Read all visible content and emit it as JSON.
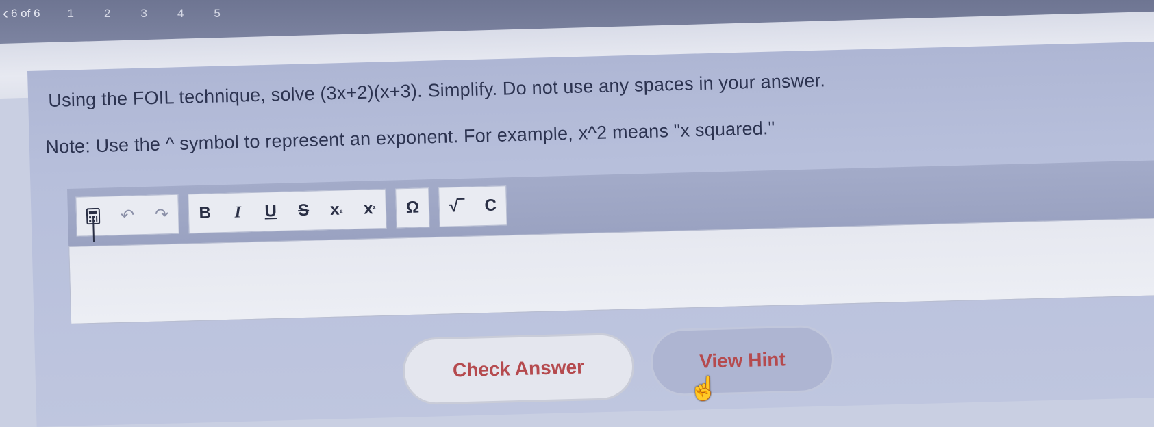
{
  "nav": {
    "back_icon": "chevron-left-icon",
    "counter": "6 of 6",
    "pages": [
      "1",
      "2",
      "3",
      "4",
      "5"
    ]
  },
  "question": {
    "text": "Using the FOIL technique, solve (3x+2)(x+3). Simplify. Do not use any spaces in your answer.",
    "note": "Note: Use the ^ symbol to represent an exponent. For example, x^2 means \"x squared.\""
  },
  "toolbar": {
    "calculator_icon": "calculator-icon",
    "undo_icon": "undo-icon",
    "redo_icon": "redo-icon",
    "bold": "B",
    "italic": "I",
    "underline": "U",
    "strikethrough": "S",
    "subscript": "x",
    "superscript": "x",
    "omega": "Ω",
    "sqrt": "√‾",
    "special": "C"
  },
  "answer": {
    "value": ""
  },
  "buttons": {
    "check": "Check Answer",
    "hint": "View Hint"
  },
  "colors": {
    "button_text": "#b54a4e",
    "card": "#b7bfdb",
    "topbar": "#7c83a0"
  }
}
